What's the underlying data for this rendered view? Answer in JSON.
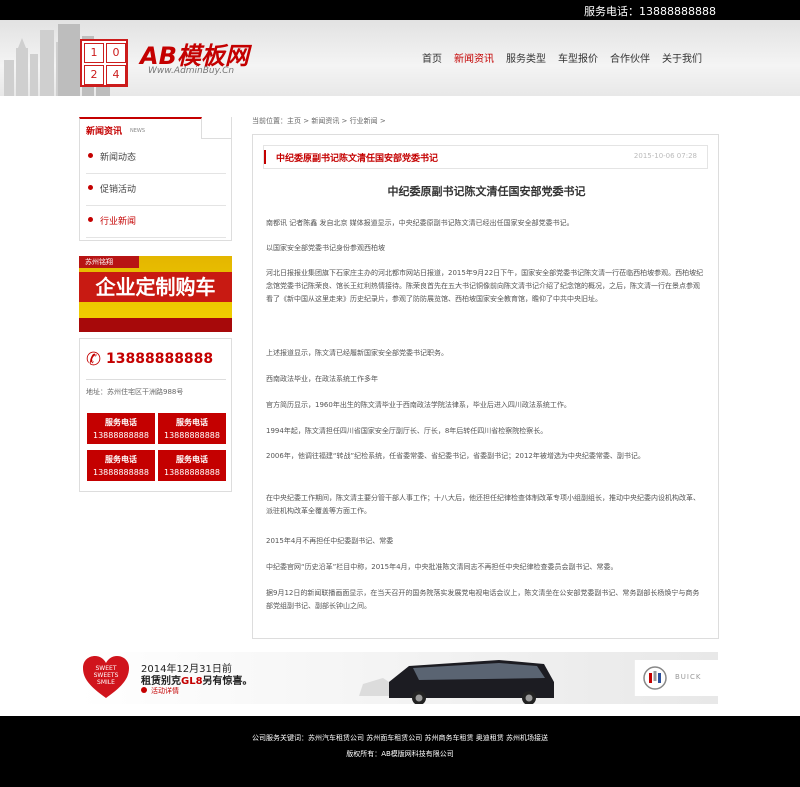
{
  "topbar": {
    "phone": "服务电话：13888888888"
  },
  "logo": {
    "cells": [
      "1",
      "0",
      "2",
      "4"
    ],
    "name": "AB模板网",
    "sub": "Www.AdminBuy.Cn"
  },
  "nav": {
    "items": [
      {
        "label": "首页"
      },
      {
        "label": "新闻资讯"
      },
      {
        "label": "服务类型"
      },
      {
        "label": "车型报价"
      },
      {
        "label": "合作伙伴"
      },
      {
        "label": "关于我们"
      }
    ],
    "active_index": 1
  },
  "breadcrumb": "当前位置：主页 > 新闻资讯 > 行业新闻 >",
  "sidebar": {
    "title": "新闻资讯",
    "title_en": "NEWS",
    "items": [
      {
        "label": "新闻动态"
      },
      {
        "label": "促销活动"
      },
      {
        "label": "行业新闻"
      }
    ],
    "active_index": 2,
    "banner": {
      "tag": "苏州铭翔",
      "text": "企业定制购车"
    },
    "contact": {
      "phone": "13888888888",
      "address": "地址：苏州住宅区干洲路988号",
      "services": [
        {
          "label": "服务电话",
          "number": "13888888888"
        },
        {
          "label": "服务电话",
          "number": "13888888888"
        },
        {
          "label": "服务电话",
          "number": "13888888888"
        },
        {
          "label": "服务电话",
          "number": "13888888888"
        }
      ]
    }
  },
  "article": {
    "bar_title": "中纪委原副书记陈文清任国安部党委书记",
    "date": "2015-10-06 07:28",
    "headline": "中纪委原副书记陈文清任国安部党委书记",
    "paragraphs": [
      "南都讯 记者陈鑫 发自北京 媒体报道显示，中央纪委原副书记陈文清已经出任国家安全部党委书记。",
      "以国家安全部党委书记身份参观西柏坡",
      "河北日报报业集团旗下石家庄主办的河北都市网站日报道，2015年9月22日下午，国家安全部党委书记陈文清一行莅临西柏坡参观。西柏坡纪念馆党委书记陈荣良、馆长王红利热情接待。陈荣良首先在五大书记铜像前向陈文清书记介绍了纪念馆的概况，之后，陈文清一行在景点参观看了《新中国从这里走来》历史纪录片，参观了防防展览馆、西柏坡国家安全教育馆，瞻仰了中共中央旧址。",
      "上述报道显示，陈文清已经履新国家安全部党委书记职务。",
      "西南政法毕业，在政法系统工作多年",
      "官方简历显示，1960年出生的陈文清毕业于西南政法学院法律系，毕业后进入四川政法系统工作。",
      "1994年起，陈文清担任四川省国家安全厅副厅长、厅长，8年后转任四川省检察院检察长。",
      "2006年，他调往福建“转战”纪检系统，任省委常委、省纪委书记，省委副书记；2012年被增选为中央纪委常委、副书记。",
      "在中央纪委工作期间，陈文清主要分管干部人事工作；十八大后，他还担任纪律检查体制改革专项小组副组长，推动中央纪委内设机构改革、派驻机构改革全覆盖等方面工作。",
      "2015年4月不再担任中纪委副书记、常委",
      "中纪委官网“历史沿革”栏目中称，2015年4月，中央批准陈文清同志不再担任中央纪律检查委员会副书记、常委。",
      "据9月12日的新闻联播画面显示，在当天召开的国务院落实发展党电视电话会议上，陈文清坐在公安部党委副书记、常务副部长杨焕宁与商务部党组副书记、副部长钟山之间。"
    ]
  },
  "ad": {
    "heart_lines": [
      "SWEET",
      "SWEETS",
      "SMILE"
    ],
    "line1": "2014年12月31日前",
    "line2_a": "租赁别克",
    "line2_b": "GL8",
    "line2_c": "另有惊喜。",
    "link": "活动详情",
    "brand": "BUICK"
  },
  "footer": {
    "keywords": "公司服务关键词：苏州汽车租赁公司 苏州面车租赁公司 苏州商务车租赁 奥迪租赁 苏州机场接送",
    "copyright": "版权所有：AB模版网科技有限公司"
  },
  "colors": {
    "brand": "#c40000",
    "footer": "#000000"
  }
}
